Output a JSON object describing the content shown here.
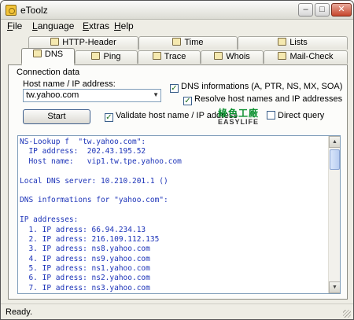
{
  "window": {
    "title": "eToolz"
  },
  "title_buttons": {
    "minimize": "–",
    "maximize": "□",
    "close": "✕"
  },
  "menu": [
    {
      "label": "File"
    },
    {
      "label": "Language"
    },
    {
      "label": "Extras"
    },
    {
      "label": "Help"
    }
  ],
  "tabs_top": [
    {
      "label": "HTTP-Header"
    },
    {
      "label": "Time"
    },
    {
      "label": "Lists"
    }
  ],
  "tabs_bottom": [
    {
      "label": "DNS",
      "active": true
    },
    {
      "label": "Ping"
    },
    {
      "label": "Trace"
    },
    {
      "label": "Whois"
    },
    {
      "label": "Mail-Check"
    }
  ],
  "connection": {
    "group_label": "Connection data",
    "host_label": "Host name / IP address:",
    "host_value": "tw.yahoo.com",
    "start_label": "Start"
  },
  "options": {
    "dns_info": {
      "label": "DNS informations (A, PTR, NS, MX, SOA)",
      "checked": true,
      "mark": "✓"
    },
    "resolve": {
      "label": "Resolve host names and IP addresses",
      "checked": true,
      "mark": "✓"
    },
    "validate": {
      "label": "Validate host name / IP address",
      "checked": true,
      "mark": "✓"
    },
    "direct": {
      "label": "Direct query",
      "checked": false,
      "mark": ""
    }
  },
  "logo": {
    "top": "綠色工廠",
    "bottom": "EASYLIFE"
  },
  "output": {
    "lines": [
      "NS-Lookup f  \"tw.yahoo.com\":",
      "  IP address:  202.43.195.52",
      "  Host name:   vip1.tw.tpe.yahoo.com",
      "",
      "Local DNS server: 10.210.201.1 ()",
      "",
      "DNS informations for \"yahoo.com\":",
      "",
      "IP addresses:",
      "  1. IP adress: 66.94.234.13",
      "  2. IP adress: 216.109.112.135",
      "  3. IP adress: ns8.yahoo.com",
      "  4. IP adress: ns9.yahoo.com",
      "  5. IP adress: ns1.yahoo.com",
      "  6. IP adress: ns2.yahoo.com",
      "  7. IP adress: ns3.yahoo.com"
    ]
  },
  "status": {
    "text": "Ready."
  },
  "colors": {
    "output_text": "#1c33b8",
    "logo_green": "#0a8f2e"
  }
}
